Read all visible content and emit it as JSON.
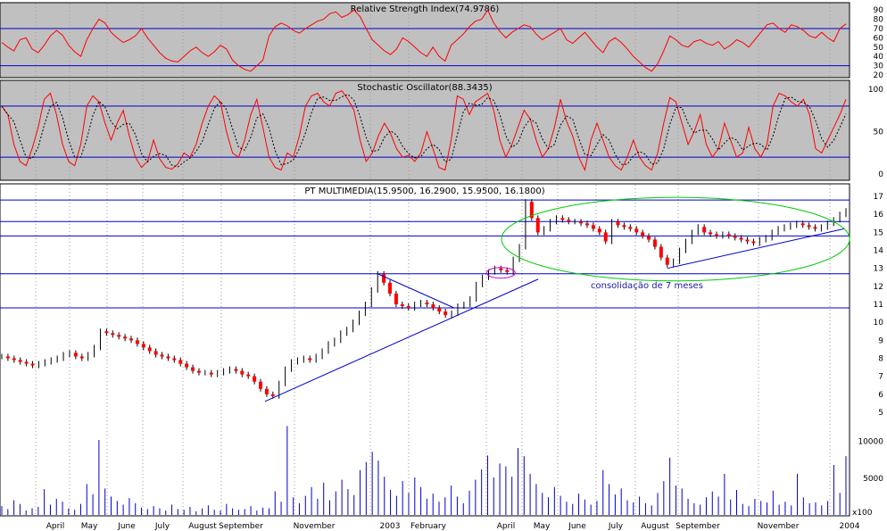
{
  "chart_data": [
    {
      "type": "line",
      "title": "Relative Strength Index(74.9786)",
      "y_ticks": [
        20,
        30,
        40,
        50,
        60,
        70,
        80,
        90
      ],
      "ylim": [
        20,
        95
      ],
      "reference_lines": [
        70,
        30
      ],
      "colors": {
        "background": "#c0c0c0",
        "line": "#ff0000",
        "reference": "#0000cc"
      },
      "series": [
        {
          "values": [
            55,
            50,
            46,
            58,
            60,
            48,
            44,
            52,
            62,
            68,
            63,
            52,
            45,
            40,
            58,
            70,
            80,
            76,
            66,
            60,
            55,
            58,
            62,
            70,
            60,
            52,
            44,
            38,
            35,
            34,
            40,
            46,
            50,
            44,
            40,
            45,
            52,
            48,
            36,
            30,
            26,
            24,
            30,
            36,
            62,
            72,
            76,
            73,
            68,
            65,
            70,
            74,
            78,
            80,
            86,
            88,
            82,
            85,
            90,
            83,
            70,
            58,
            52,
            46,
            42,
            48,
            60,
            56,
            50,
            44,
            40,
            50,
            40,
            35,
            52,
            58,
            64,
            72,
            78,
            80,
            90,
            76,
            67,
            60,
            66,
            70,
            74,
            72,
            64,
            58,
            62,
            66,
            70,
            58,
            54,
            60,
            66,
            58,
            50,
            44,
            56,
            60,
            55,
            48,
            40,
            34,
            28,
            24,
            32,
            46,
            62,
            58,
            52,
            50,
            56,
            58,
            54,
            52,
            56,
            48,
            52,
            58,
            55,
            50,
            58,
            66,
            74,
            76,
            70,
            66,
            74,
            72,
            68,
            62,
            60,
            66,
            60,
            56,
            70,
            75
          ]
        }
      ]
    },
    {
      "type": "line",
      "title": "Stochastic Oscillator(88.3435)",
      "y_ticks": [
        0,
        50,
        100
      ],
      "ylim": [
        -5,
        105
      ],
      "reference_lines": [
        80,
        20
      ],
      "colors": {
        "background": "#c0c0c0",
        "line": "#ff0000",
        "signal": "#000000",
        "reference": "#0000cc"
      },
      "series": [
        {
          "values": [
            80,
            70,
            35,
            15,
            10,
            30,
            55,
            88,
            95,
            70,
            35,
            15,
            10,
            35,
            80,
            92,
            85,
            60,
            40,
            60,
            75,
            45,
            20,
            8,
            15,
            40,
            18,
            8,
            6,
            12,
            25,
            20,
            35,
            60,
            80,
            92,
            85,
            50,
            25,
            20,
            40,
            70,
            88,
            55,
            20,
            8,
            5,
            25,
            20,
            45,
            80,
            92,
            95,
            85,
            80,
            95,
            98,
            88,
            75,
            40,
            15,
            25,
            45,
            60,
            48,
            30,
            20,
            22,
            15,
            25,
            50,
            30,
            8,
            5,
            40,
            92,
            88,
            70,
            85,
            90,
            95,
            75,
            40,
            20,
            35,
            55,
            75,
            65,
            40,
            20,
            30,
            55,
            88,
            62,
            45,
            20,
            5,
            40,
            60,
            40,
            20,
            10,
            5,
            20,
            40,
            20,
            10,
            5,
            25,
            60,
            90,
            85,
            60,
            35,
            50,
            70,
            35,
            20,
            30,
            60,
            40,
            20,
            25,
            55,
            30,
            20,
            35,
            80,
            95,
            92,
            85,
            80,
            88,
            70,
            30,
            25,
            40,
            55,
            70,
            88
          ]
        }
      ]
    },
    {
      "type": "line",
      "title": "PT MULTIMEDIA(15.9500, 16.2900, 15.9500, 16.1800)",
      "y_ticks": [
        5,
        6,
        7,
        8,
        9,
        10,
        11,
        12,
        13,
        14,
        15,
        16,
        17
      ],
      "ylim": [
        4.6,
        17.6
      ],
      "x_tick_labels": [
        "April",
        "May",
        "June",
        "July",
        "August",
        "September",
        "November",
        "2003",
        "February",
        "April",
        "May",
        "June",
        "July",
        "August",
        "September",
        "November",
        "2004"
      ],
      "horizontal_levels": [
        16.8,
        15.6,
        14.8,
        12.7,
        10.8
      ],
      "annotation": "consolidação de 7 meses",
      "colors": {
        "background": "#ffffff",
        "price": "#000000",
        "down_bar": "#ff0000",
        "lines": "#0000cc",
        "ellipse": "#00cc00",
        "marker": "#cc00cc"
      },
      "series": [
        {
          "values": [
            8.1,
            8.0,
            7.9,
            7.8,
            7.7,
            7.6,
            7.7,
            7.8,
            7.9,
            8.0,
            8.2,
            8.3,
            8.1,
            8.0,
            8.2,
            8.6,
            9.5,
            9.4,
            9.3,
            9.2,
            9.1,
            9.0,
            8.8,
            8.6,
            8.4,
            8.2,
            8.1,
            8.0,
            7.9,
            7.7,
            7.5,
            7.3,
            7.2,
            7.2,
            7.1,
            7.2,
            7.3,
            7.4,
            7.3,
            7.1,
            7.0,
            6.7,
            6.3,
            6.0,
            5.9,
            6.6,
            7.4,
            7.8,
            7.9,
            8.0,
            7.9,
            8.1,
            8.4,
            8.8,
            9.0,
            9.4,
            9.6,
            10.0,
            10.5,
            11.0,
            11.8,
            12.7,
            12.2,
            11.6,
            11.0,
            10.9,
            10.8,
            11.0,
            11.1,
            11.0,
            10.8,
            10.6,
            10.4,
            10.5,
            10.9,
            11.0,
            11.3,
            12.1,
            12.5,
            12.8,
            13.0,
            12.9,
            12.8,
            13.5,
            14.2,
            16.7,
            15.8,
            15.0,
            15.2,
            15.6,
            15.8,
            15.7,
            15.6,
            15.6,
            15.5,
            15.4,
            15.2,
            15.0,
            14.5,
            15.6,
            15.4,
            15.3,
            15.2,
            15.0,
            14.8,
            14.6,
            14.2,
            13.6,
            13.2,
            13.4,
            14.0,
            14.5,
            15.0,
            15.3,
            15.0,
            14.9,
            14.8,
            14.9,
            14.8,
            14.7,
            14.6,
            14.5,
            14.4,
            14.6,
            14.7,
            15.0,
            15.2,
            15.3,
            15.4,
            15.5,
            15.4,
            15.3,
            15.2,
            15.3,
            15.5,
            15.7,
            16.0,
            16.2
          ]
        }
      ]
    },
    {
      "type": "bar",
      "unit_label": "x100",
      "y_ticks": [
        5000,
        10000
      ],
      "ylim": [
        0,
        13000
      ],
      "colors": {
        "bar": "#0000cc"
      },
      "series": [
        {
          "values": [
            1200,
            800,
            2000,
            1500,
            600,
            900,
            1100,
            3500,
            1400,
            2200,
            1800,
            900,
            700,
            1500,
            4200,
            2800,
            10200,
            3600,
            2500,
            1900,
            1400,
            2300,
            1600,
            1000,
            800,
            1200,
            900,
            600,
            1400,
            800,
            700,
            1100,
            500,
            900,
            1300,
            700,
            600,
            1500,
            900,
            700,
            800,
            1200,
            600,
            1000,
            900,
            3200,
            1800,
            12100,
            2400,
            1600,
            2600,
            3800,
            2200,
            4400,
            2000,
            3200,
            4800,
            3500,
            2700,
            6100,
            7200,
            8600,
            7400,
            5200,
            3400,
            2600,
            4600,
            3000,
            5100,
            3800,
            2200,
            2900,
            1800,
            2400,
            4000,
            2500,
            1600,
            3300,
            4800,
            6200,
            8100,
            5100,
            7000,
            6600,
            5200,
            9100,
            8000,
            5600,
            4200,
            3000,
            2400,
            3800,
            2600,
            1800,
            1500,
            2900,
            2100,
            1400,
            1900,
            6100,
            4200,
            2800,
            3600,
            2000,
            1700,
            2500,
            1600,
            1300,
            3000,
            4600,
            7800,
            4000,
            3600,
            2200,
            1600,
            1400,
            2400,
            3200,
            2500,
            5600,
            2100,
            3400,
            1500,
            1200,
            2200,
            1900,
            1700,
            3300,
            1400,
            1800,
            1300,
            5600,
            2400,
            1600,
            1700,
            1300,
            1900,
            6800,
            3000,
            8000
          ]
        }
      ]
    }
  ]
}
